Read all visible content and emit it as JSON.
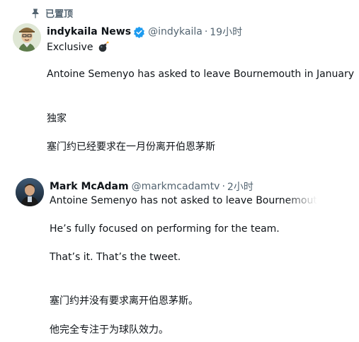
{
  "pinned": {
    "label": "已置顶",
    "icon": "pin-icon"
  },
  "tweet1": {
    "display_name": "indykaila News",
    "handle": "@indykaila",
    "separator": "·",
    "time": "19小时",
    "verified": true,
    "lines": [
      "Exclusive",
      "Antoine Semenyo has asked to leave Bournemouth in January",
      "独家",
      "塞门约已经要求在一月份离开伯恩茅斯"
    ],
    "emoji": "bomb-icon"
  },
  "tweet2": {
    "display_name": "Mark McAdam",
    "handle": "@markmcadamtv",
    "separator": "·",
    "time": "2小时",
    "lines": [
      "Antoine Semenyo has not asked to leave Bournemouth",
      "He’s fully focused on performing for the team.",
      "That’s it. That’s the tweet.",
      "塞门约并没有要求离开伯恩茅斯。",
      "他完全专注于为球队效力。"
    ]
  },
  "colors": {
    "text": "#0f1419",
    "secondary": "#536471",
    "verified": "#1d9bf0"
  }
}
